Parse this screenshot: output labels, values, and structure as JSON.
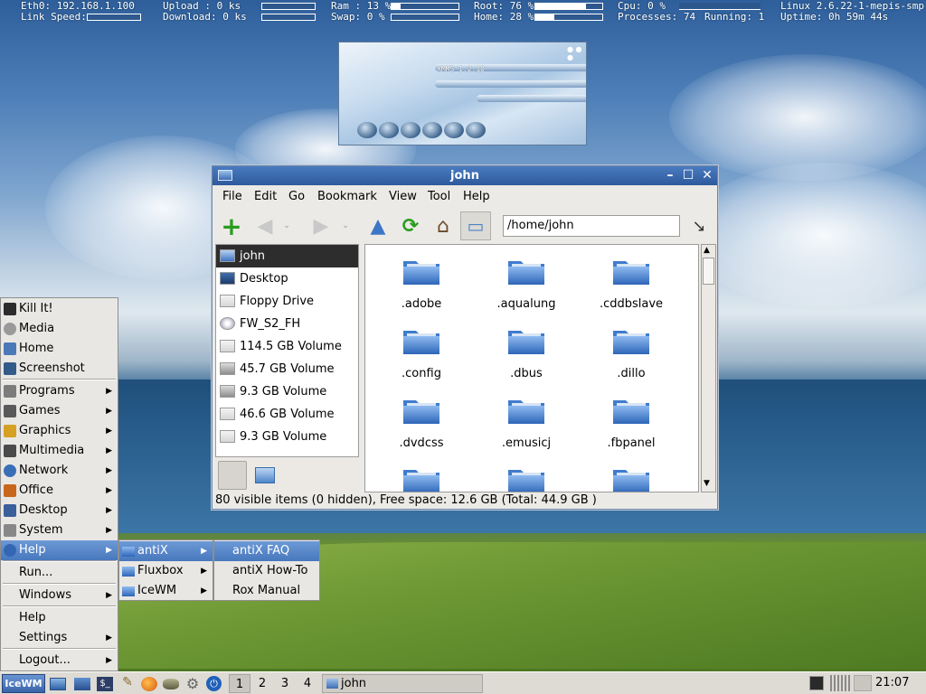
{
  "conky": {
    "eth0": "Eth0: 192.168.1.100",
    "link_speed": "Link Speed:",
    "upload": "Upload  : 0     ks",
    "download": "Download: 0     ks",
    "ram": "Ram : 13 %",
    "swap": "Swap: 0  %",
    "root": "Root: 76 %",
    "home": "Home: 28 %",
    "cpu": "Cpu:  0  %",
    "processes": "Processes: 74",
    "running": "Running: 1",
    "kernel": "Linux 2.6.22-1-mepis-smp",
    "uptime": "Uptime: 0h 59m 44s",
    "ram_pct": 13,
    "root_pct": 76,
    "home_pct": 28
  },
  "xmms": {
    "title": "XMMS 1.2.10"
  },
  "window": {
    "title": "john",
    "menus": [
      "File",
      "Edit",
      "Go",
      "Bookmark",
      "View",
      "Tool",
      "Help"
    ],
    "path": "/home/john",
    "places": [
      {
        "label": "john",
        "icon": "home-folder-icon",
        "selected": true
      },
      {
        "label": "Desktop",
        "icon": "desktop-icon"
      },
      {
        "label": "Floppy Drive",
        "icon": "drive-icon"
      },
      {
        "label": "FW_S2_FH",
        "icon": "cdrom-icon"
      },
      {
        "label": "114.5 GB Volume",
        "icon": "drive-icon"
      },
      {
        "label": "45.7 GB Volume",
        "icon": "harddisk-icon"
      },
      {
        "label": "9.3 GB Volume",
        "icon": "harddisk-icon"
      },
      {
        "label": "46.6 GB Volume",
        "icon": "drive-icon"
      },
      {
        "label": "9.3 GB Volume",
        "icon": "drive-icon"
      }
    ],
    "files": [
      ".adobe",
      ".aqualung",
      ".cddbslave",
      ".config",
      ".dbus",
      ".dillo",
      ".dvdcss",
      ".emusicj",
      ".fbpanel",
      "",
      "",
      ""
    ],
    "status": "80 visible items (0 hidden), Free space: 12.6 GB (Total: 44.9 GB )"
  },
  "start_menu": {
    "items": [
      {
        "label": "Kill It!",
        "icon": "kill-icon",
        "submenu": false
      },
      {
        "label": "Media",
        "icon": "media-icon",
        "submenu": false
      },
      {
        "label": "Home",
        "icon": "home-icon",
        "submenu": false
      },
      {
        "label": "Screenshot",
        "icon": "screenshot-icon",
        "submenu": false
      },
      {
        "label": "Programs",
        "icon": "programs-icon",
        "submenu": true
      },
      {
        "label": "Games",
        "icon": "games-icon",
        "submenu": true
      },
      {
        "label": "Graphics",
        "icon": "graphics-icon",
        "submenu": true
      },
      {
        "label": "Multimedia",
        "icon": "multimedia-icon",
        "submenu": true
      },
      {
        "label": "Network",
        "icon": "network-icon",
        "submenu": true
      },
      {
        "label": "Office",
        "icon": "office-icon",
        "submenu": true
      },
      {
        "label": "Desktop",
        "icon": "desktop-icon",
        "submenu": true
      },
      {
        "label": "System",
        "icon": "system-icon",
        "submenu": true
      },
      {
        "label": "Help",
        "icon": "help-icon",
        "submenu": true,
        "highlighted": true
      },
      {
        "label": "Run...",
        "submenu": false
      },
      {
        "label": "Windows",
        "submenu": true
      },
      {
        "label": "Help",
        "submenu": false
      },
      {
        "label": "Settings",
        "submenu": true
      },
      {
        "label": "Logout...",
        "submenu": true
      }
    ]
  },
  "help_submenu": {
    "items": [
      {
        "label": "antiX",
        "highlighted": true
      },
      {
        "label": "Fluxbox"
      },
      {
        "label": "IceWM"
      }
    ]
  },
  "antix_submenu": {
    "items": [
      {
        "label": "antiX FAQ",
        "highlighted": true
      },
      {
        "label": "antiX How-To"
      },
      {
        "label": "Rox Manual"
      }
    ]
  },
  "taskbar": {
    "start_label": "IceWM",
    "workspaces": [
      "1",
      "2",
      "3",
      "4"
    ],
    "active_workspace": "1",
    "task_title": "john",
    "clock": "21:07"
  }
}
